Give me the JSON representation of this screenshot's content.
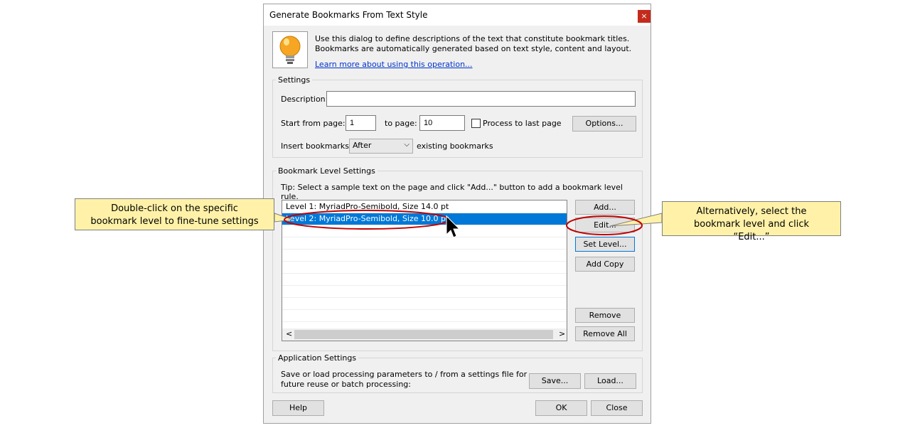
{
  "dialog": {
    "title": "Generate Bookmarks From Text Style",
    "close_label": "×",
    "info_text": "Use this dialog to define descriptions of the text that constitute bookmark titles. Bookmarks are automatically generated based on text style, content and layout.",
    "info_link": "Learn more about using this operation...",
    "info_icon": "lightbulb-icon"
  },
  "settings": {
    "group_label": "Settings",
    "description_label": "Description:",
    "description_value": "",
    "start_label": "Start from page:",
    "start_value": "1",
    "to_label": "to page:",
    "to_value": "10",
    "process_last_label": "Process to last page",
    "process_last_checked": false,
    "options_label": "Options...",
    "insert_label": "Insert bookmarks:",
    "insert_value": "After",
    "existing_label": "existing bookmarks"
  },
  "levels": {
    "group_label": "Bookmark Level Settings",
    "tip": "Tip: Select a sample text on the page and click \"Add...\" button to add a bookmark level rule.",
    "rows": [
      {
        "text": "Level 1: MyriadPro-Semibold, Size 14.0 pt",
        "selected": false
      },
      {
        "text": "Level 2: MyriadPro-Semibold, Size 10.0 pt",
        "selected": true
      }
    ],
    "add_label": "Add...",
    "edit_label": "Edit...",
    "set_level_label": "Set Level...",
    "add_copy_label": "Add Copy",
    "remove_label": "Remove",
    "remove_all_label": "Remove All",
    "scroll_left": "<",
    "scroll_right": ">"
  },
  "app_settings": {
    "group_label": "Application Settings",
    "text": "Save or load processing parameters to / from a settings file for future reuse or batch processing:",
    "save_label": "Save...",
    "load_label": "Load..."
  },
  "footer": {
    "help_label": "Help",
    "ok_label": "OK",
    "close_label": "Close"
  },
  "callouts": {
    "left": "Double-click on the specific bookmark level to fine-tune settings",
    "right": "Alternatively, select the bookmark level and click “Edit...”"
  },
  "colors": {
    "selection": "#0078d7",
    "callout_fill": "#fff2a8",
    "highlight_ellipse": "#c00000"
  }
}
